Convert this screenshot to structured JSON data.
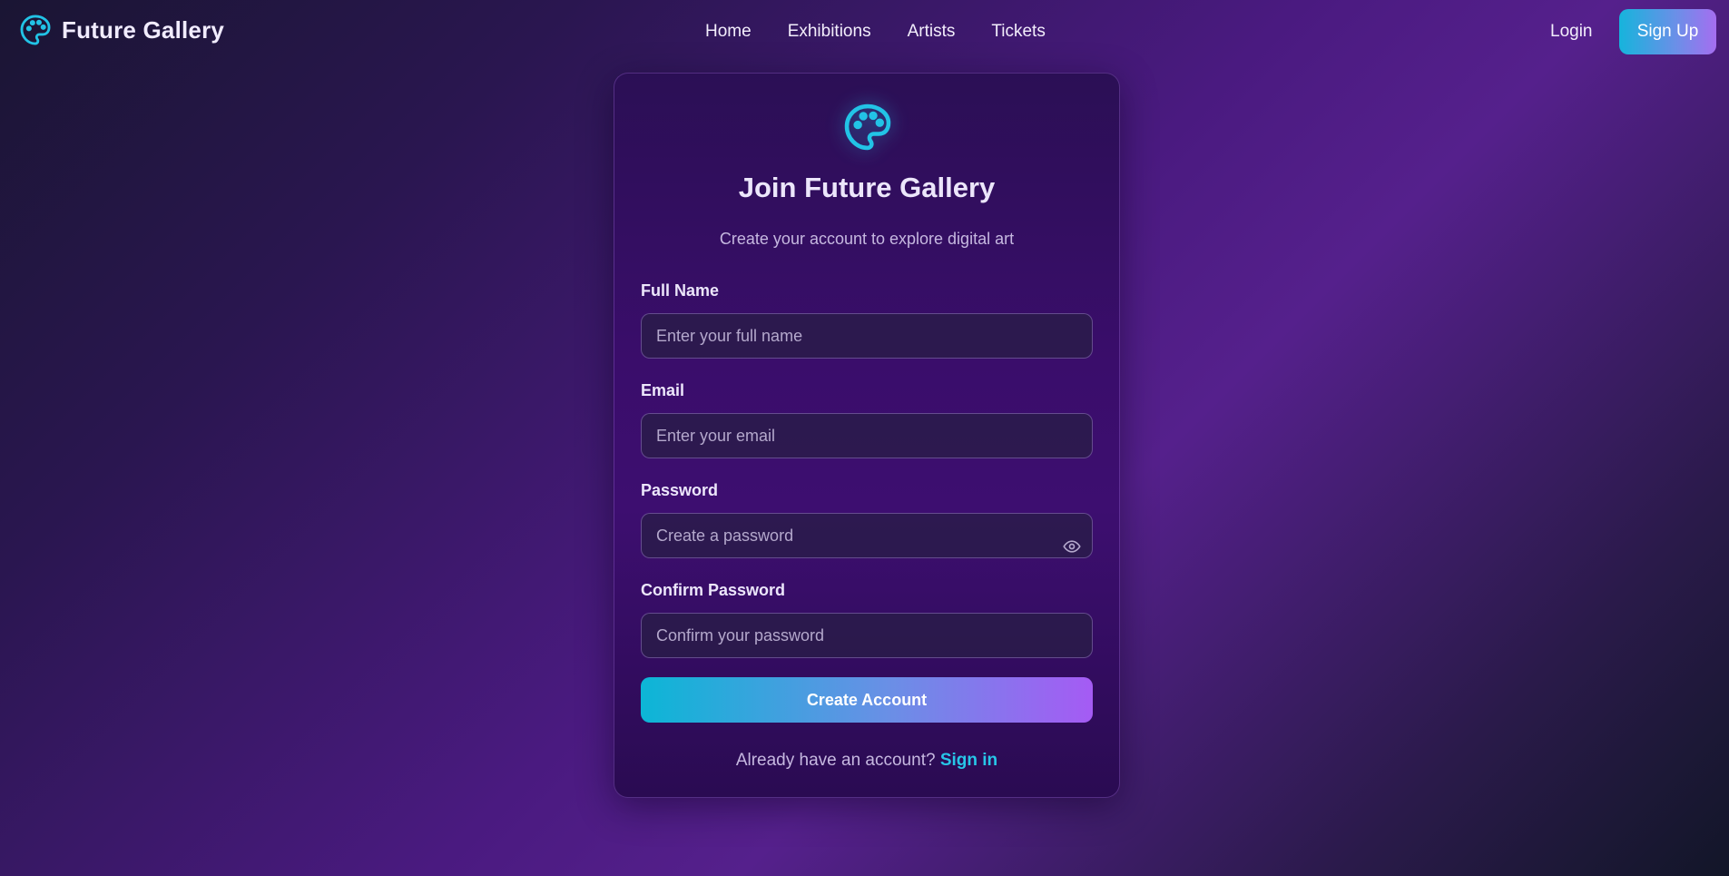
{
  "brand": {
    "name": "Future Gallery",
    "icon": "palette-icon",
    "accent_color": "#22c3e6"
  },
  "nav": {
    "links": [
      "Home",
      "Exhibitions",
      "Artists",
      "Tickets"
    ],
    "login_label": "Login",
    "signup_label": "Sign Up"
  },
  "signup_card": {
    "icon": "palette-icon",
    "title": "Join Future Gallery",
    "subtitle": "Create your account to explore digital art",
    "fields": {
      "full_name": {
        "label": "Full Name",
        "placeholder": "Enter your full name",
        "value": ""
      },
      "email": {
        "label": "Email",
        "placeholder": "Enter your email",
        "value": ""
      },
      "password": {
        "label": "Password",
        "placeholder": "Create a password",
        "value": "",
        "toggle_icon": "eye-icon"
      },
      "confirm_password": {
        "label": "Confirm Password",
        "placeholder": "Confirm your password",
        "value": ""
      }
    },
    "submit_label": "Create Account",
    "footer_text": "Already have an account?",
    "footer_link": "Sign in"
  },
  "colors": {
    "primary_gradient_start": "#0cb6d6",
    "primary_gradient_end": "#a55bf4",
    "link": "#27c6e8"
  }
}
